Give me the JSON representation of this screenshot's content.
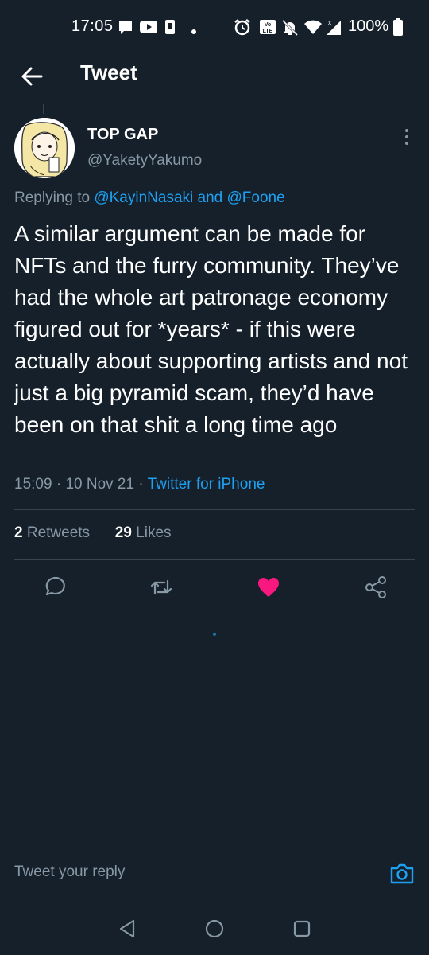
{
  "status_bar": {
    "time": "17:05",
    "battery": "100%",
    "icons": [
      "message-icon",
      "youtube-icon",
      "phone-icon",
      "dot-icon",
      "alarm-icon",
      "volte-icon",
      "mute-icon",
      "wifi-icon",
      "signal-icon",
      "battery-icon"
    ]
  },
  "header": {
    "title": "Tweet",
    "back_icon": "arrow-left-icon"
  },
  "tweet": {
    "display_name": "TOP GAP",
    "handle": "@YaketyYakumo",
    "replying_prefix": "Replying to ",
    "mention_1": "@KayinNasaki",
    "replying_and": " and ",
    "mention_2": "@Foone",
    "text": "A similar argument can be made for NFTs and the furry community. They’ve had the whole art patronage economy figured out for *years* - if this were actually about supporting artists and not just a big pyramid scam, they’d have been on that shit a long time ago",
    "time": "15:09",
    "date": "10 Nov 21",
    "separator": " · ",
    "source": "Twitter for iPhone",
    "retweets_count": "2",
    "retweets_label": "Retweets",
    "likes_count": "29",
    "likes_label": "Likes"
  },
  "actions": [
    {
      "name": "reply-icon"
    },
    {
      "name": "retweet-icon"
    },
    {
      "name": "like-icon",
      "active": true,
      "color": "#f91880"
    },
    {
      "name": "share-icon"
    }
  ],
  "reply_bar": {
    "placeholder": "Tweet your reply",
    "camera_icon": "camera-icon"
  },
  "colors": {
    "background": "#15202b",
    "accent": "#1da1f2",
    "secondary_text": "#8899a6",
    "divider": "#38444d",
    "like": "#f91880"
  }
}
